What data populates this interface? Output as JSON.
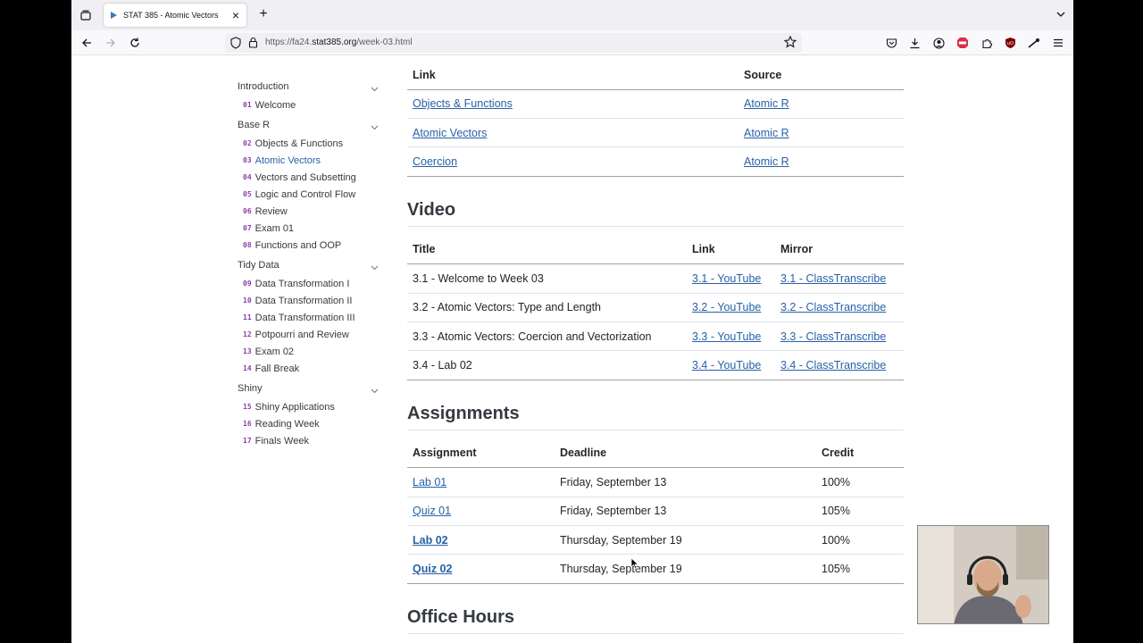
{
  "browser": {
    "tab": {
      "title": "STAT 385 - Atomic Vectors",
      "close": "×"
    },
    "newtab": "+",
    "url_prefix": "https://fa24.",
    "url_host": "stat385.org",
    "url_path": "/week-03.html"
  },
  "sidebar": {
    "sections": [
      {
        "title": "Introduction",
        "items": [
          {
            "num": "01",
            "label": "Welcome"
          }
        ]
      },
      {
        "title": "Base R",
        "items": [
          {
            "num": "02",
            "label": "Objects & Functions"
          },
          {
            "num": "03",
            "label": "Atomic Vectors",
            "active": true
          },
          {
            "num": "04",
            "label": "Vectors and Subsetting"
          },
          {
            "num": "05",
            "label": "Logic and Control Flow"
          },
          {
            "num": "06",
            "label": "Review"
          },
          {
            "num": "07",
            "label": "Exam 01"
          },
          {
            "num": "08",
            "label": "Functions and OOP"
          }
        ]
      },
      {
        "title": "Tidy Data",
        "items": [
          {
            "num": "09",
            "label": "Data Transformation I"
          },
          {
            "num": "10",
            "label": "Data Transformation II"
          },
          {
            "num": "11",
            "label": "Data Transformation III"
          },
          {
            "num": "12",
            "label": "Potpourri and Review"
          },
          {
            "num": "13",
            "label": "Exam 02"
          },
          {
            "num": "14",
            "label": "Fall Break"
          }
        ]
      },
      {
        "title": "Shiny",
        "items": [
          {
            "num": "15",
            "label": "Shiny Applications"
          },
          {
            "num": "16",
            "label": "Reading Week"
          },
          {
            "num": "17",
            "label": "Finals Week"
          }
        ]
      }
    ]
  },
  "reading": {
    "headers": [
      "Link",
      "Source"
    ],
    "rows": [
      [
        "Objects & Functions",
        "Atomic R"
      ],
      [
        "Atomic Vectors",
        "Atomic R"
      ],
      [
        "Coercion",
        "Atomic R"
      ]
    ]
  },
  "video": {
    "heading": "Video",
    "headers": [
      "Title",
      "Link",
      "Mirror"
    ],
    "rows": [
      [
        "3.1 - Welcome to Week 03",
        "3.1 - YouTube",
        "3.1 - ClassTranscribe"
      ],
      [
        "3.2 - Atomic Vectors: Type and Length",
        "3.2 - YouTube",
        "3.2 - ClassTranscribe"
      ],
      [
        "3.3 - Atomic Vectors: Coercion and Vectorization",
        "3.3 - YouTube",
        "3.3 - ClassTranscribe"
      ],
      [
        "3.4 - Lab 02",
        "3.4 - YouTube",
        "3.4 - ClassTranscribe"
      ]
    ]
  },
  "assignments": {
    "heading": "Assignments",
    "headers": [
      "Assignment",
      "Deadline",
      "Credit"
    ],
    "rows": [
      [
        "Lab 01",
        "Friday, September 13",
        "100%"
      ],
      [
        "Quiz 01",
        "Friday, September 13",
        "105%"
      ],
      [
        "Lab 02",
        "Thursday, September 19",
        "100%"
      ],
      [
        "Quiz 02",
        "Thursday, September 19",
        "105%"
      ]
    ]
  },
  "office_hours": {
    "heading": "Office Hours"
  }
}
